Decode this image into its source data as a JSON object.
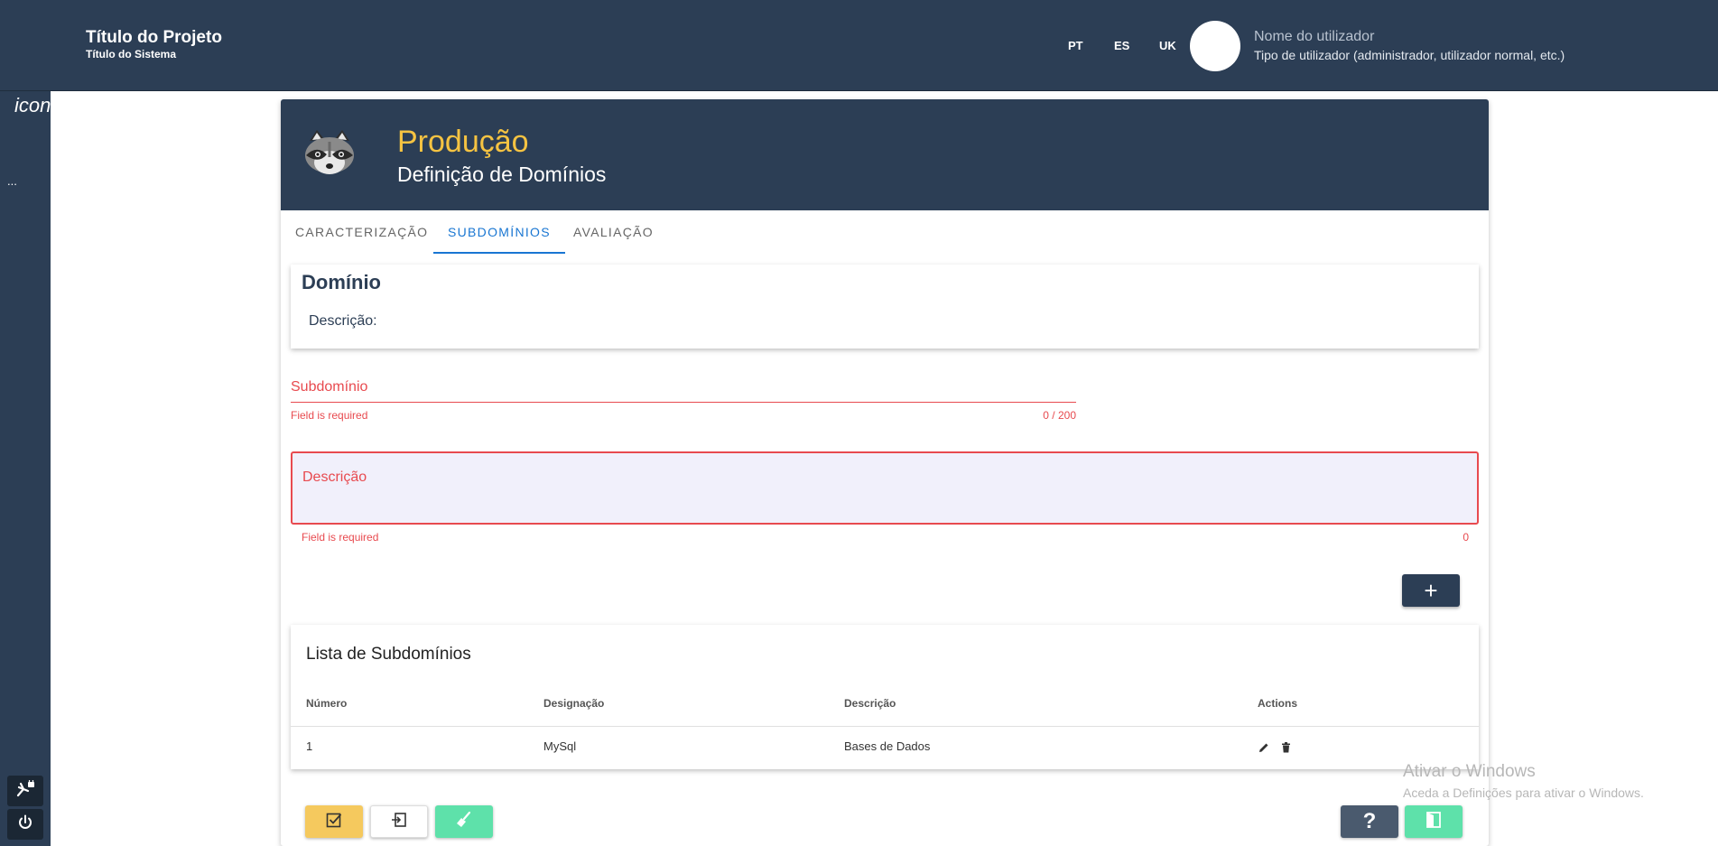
{
  "header": {
    "project_title": "Título do Projeto",
    "system_title": "Título do Sistema",
    "languages": [
      "PT",
      "ES",
      "UK"
    ],
    "user_name": "Nome do utilizador",
    "user_type": "Tipo de utilizador (administrador, utilizador normal, etc.)"
  },
  "rail": {
    "icon_text": "icon mdi icon mdi",
    "dots": "...",
    "icons": [
      "account-lock-icon",
      "power-icon"
    ]
  },
  "page": {
    "title": "Produção",
    "subtitle": "Definição de Domínios",
    "logo_icon": "raccoon-logo"
  },
  "tabs": [
    {
      "label": "Caracterização",
      "active": false
    },
    {
      "label": "Subdomínios",
      "active": true
    },
    {
      "label": "Avaliação",
      "active": false
    }
  ],
  "domain": {
    "title": "Domínio",
    "description_label": "Descrição:"
  },
  "form": {
    "subdomain_label": "Subdomínio",
    "subdomain_error": "Field is required",
    "subdomain_counter": "0 / 200",
    "description_label": "Descrição",
    "description_error": "Field is required",
    "description_counter": "0",
    "add_button": "+"
  },
  "list": {
    "title": "Lista de Subdomínios",
    "columns": [
      "Número",
      "Designação",
      "Descrição",
      "Actions"
    ],
    "rows": [
      {
        "numero": "1",
        "designacao": "MySql",
        "descricao": "Bases de Dados"
      }
    ]
  },
  "bottom_buttons": [
    "check-icon",
    "login-icon",
    "broom-icon",
    "help-icon",
    "exit-door-icon"
  ],
  "help_label": "?",
  "watermark": {
    "line1": "Ativar o Windows",
    "line2": "Aceda a Definições para ativar o Windows."
  },
  "colors": {
    "navy": "#2c3e55",
    "accent_yellow": "#f5c342",
    "error_red": "#e84a4f",
    "active_tab": "#1976d2",
    "green": "#5ee1aa"
  }
}
